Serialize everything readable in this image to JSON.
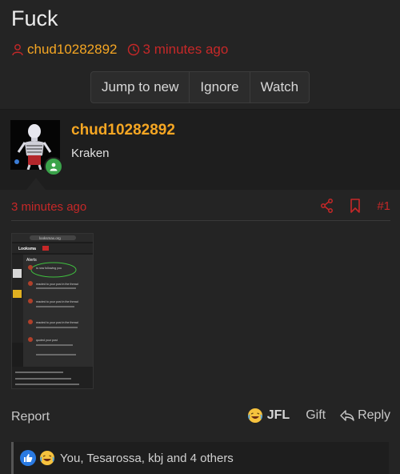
{
  "thread": {
    "title": "Fuck",
    "author": "chud10282892",
    "time": "3 minutes ago",
    "buttons": {
      "jump": "Jump to new",
      "ignore": "Ignore",
      "watch": "Watch"
    }
  },
  "user": {
    "name": "chud10282892",
    "title": "Kraken"
  },
  "post": {
    "time": "3 minutes ago",
    "number": "#1",
    "attachment": {
      "url_bar": "looksmax.org",
      "site_name": "Looksma",
      "panel_title": "Alerts",
      "alerts": [
        "is now following you",
        "reacted to your post in the thread",
        "reacted to your post in the thread",
        "reacted to your post in the thread",
        "quoted your post"
      ]
    }
  },
  "footer": {
    "report": "Report",
    "jfl": "JFL",
    "gift": "Gift",
    "reply": "Reply"
  },
  "reactions": {
    "text": "You, Tesarossa, kbj and 4 others"
  },
  "colors": {
    "accent_orange": "#f5a623",
    "accent_red": "#c62828",
    "like_blue": "#2a7ae2",
    "online_green": "#3aa34a"
  }
}
